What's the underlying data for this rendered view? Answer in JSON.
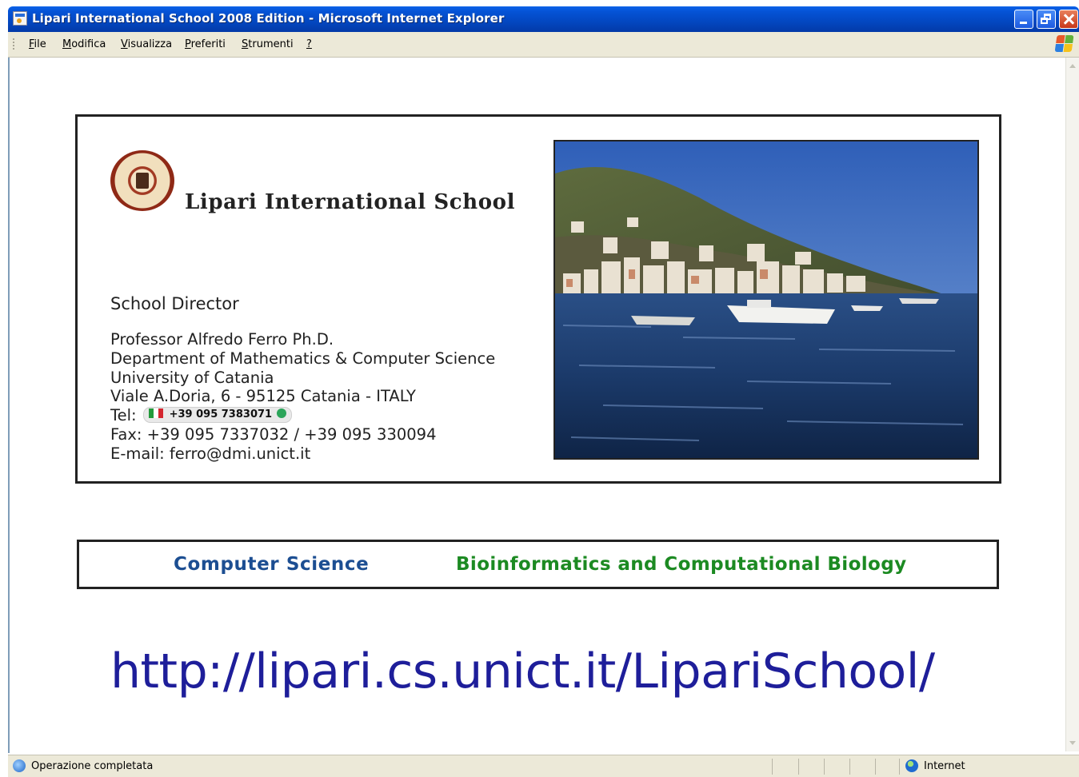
{
  "window": {
    "title": "Lipari International School 2008 Edition - Microsoft Internet Explorer"
  },
  "menu": {
    "items": [
      {
        "label": "File",
        "accel": "F",
        "rest": "ile"
      },
      {
        "label": "Modifica",
        "accel": "M",
        "rest": "odifica"
      },
      {
        "label": "Visualizza",
        "accel": "V",
        "rest": "isualizza"
      },
      {
        "label": "Preferiti",
        "accel": "P",
        "rest": "referiti"
      },
      {
        "label": "Strumenti",
        "accel": "S",
        "rest": "trumenti"
      },
      {
        "label": "?",
        "accel": "?",
        "rest": ""
      }
    ]
  },
  "page": {
    "school_name": "Lipari International School",
    "director_label": "School Director",
    "contact": {
      "name": "Professor Alfredo Ferro Ph.D.",
      "department": "Department of Mathematics & Computer Science",
      "university": "University of Catania",
      "address": "Viale A.Doria, 6 - 95125 Catania - ITALY",
      "tel_label": "Tel:",
      "tel_number": "+39 095 7383071",
      "fax": "Fax: +39 095 7337032 / +39 095 330094",
      "email": "E-mail: ferro@dmi.unict.it"
    },
    "tracks": {
      "computer_science": "Computer Science",
      "bioinformatics": "Bioinformatics and Computational Biology"
    },
    "url": "http://lipari.cs.unict.it/LipariSchool/"
  },
  "statusbar": {
    "status": "Operazione completata",
    "zone": "Internet"
  },
  "colors": {
    "titlebar": "#0553d6",
    "chrome": "#ece9d8",
    "cs_track": "#1c4e92",
    "bio_track": "#1c8a22",
    "url": "#1e1e9a"
  }
}
